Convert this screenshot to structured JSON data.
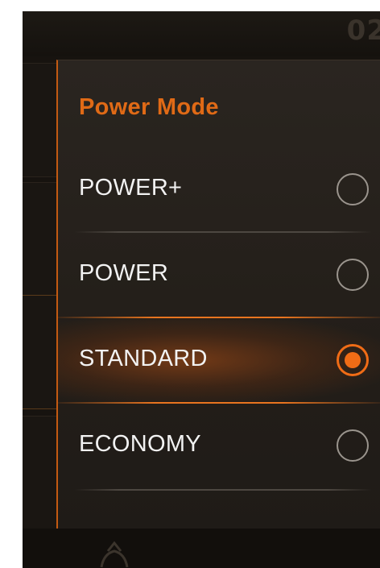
{
  "header": {
    "clock_partial": "02"
  },
  "power_mode": {
    "title": "Power Mode",
    "options": [
      {
        "label": "POWER+",
        "selected": false
      },
      {
        "label": "POWER",
        "selected": false
      },
      {
        "label": "STANDARD",
        "selected": true
      },
      {
        "label": "ECONOMY",
        "selected": false
      }
    ],
    "accent_color": "#f06c16"
  },
  "footer": {
    "icon": "gear-icon"
  }
}
